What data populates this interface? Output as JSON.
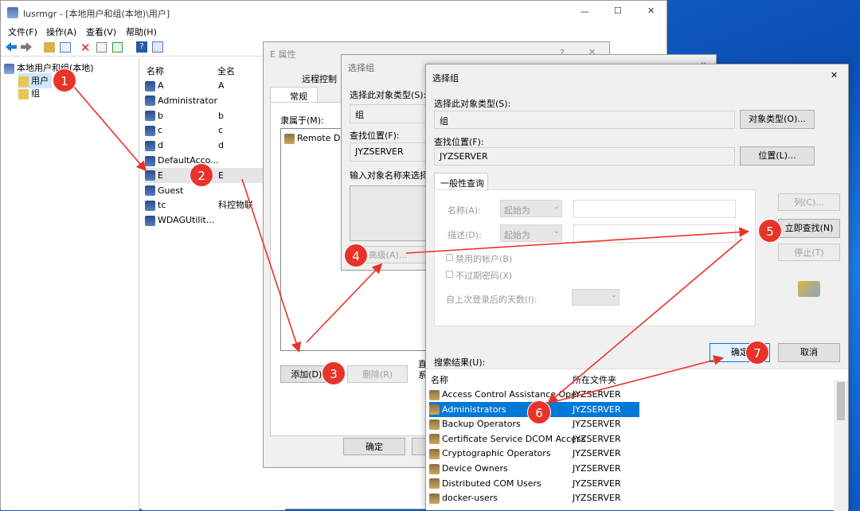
{
  "main": {
    "title": "lusrmgr - [本地用户和组(本地)\\用户]",
    "menu": [
      "文件(F)",
      "操作(A)",
      "查看(V)",
      "帮助(H)"
    ],
    "tree": {
      "root": "本地用户和组(本地)",
      "users": "用户",
      "groups": "组"
    },
    "list_headers": {
      "name": "名称",
      "fullname": "全名"
    },
    "users": [
      {
        "name": "A",
        "full": "A"
      },
      {
        "name": "Administrator",
        "full": ""
      },
      {
        "name": "b",
        "full": "b"
      },
      {
        "name": "c",
        "full": "c"
      },
      {
        "name": "d",
        "full": "d"
      },
      {
        "name": "DefaultAcco...",
        "full": ""
      },
      {
        "name": "E",
        "full": "E"
      },
      {
        "name": "Guest",
        "full": ""
      },
      {
        "name": "tc",
        "full": "科控物联"
      },
      {
        "name": "WDAGUtilit...",
        "full": ""
      }
    ],
    "win_controls": {
      "min": "—",
      "max": "☐",
      "close": "✕"
    }
  },
  "props": {
    "title": "E 属性",
    "help": "?",
    "close": "✕",
    "tabs": [
      "远程控制",
      "常规"
    ],
    "member_of": "隶属于(M):",
    "member_item": "Remote Des",
    "add": "添加(D)...",
    "remove": "删除(R)",
    "note1": "直",
    "note2": "系",
    "ok": "确定"
  },
  "sel1": {
    "title": "选择组",
    "close": "✕",
    "type_label": "选择此对象类型(S):",
    "type_value": "组",
    "loc_label": "查找位置(F):",
    "loc_value": "JYZSERVER",
    "enter_label": "输入对象名称来选择",
    "advanced": "高级(A)..."
  },
  "sel2": {
    "title": "选择组",
    "close": "✕",
    "type_label": "选择此对象类型(S):",
    "type_value": "组",
    "type_btn": "对象类型(O)...",
    "loc_label": "查找位置(F):",
    "loc_value": "JYZSERVER",
    "loc_btn": "位置(L)...",
    "tab": "一般性查询",
    "name_label": "名称(A):",
    "desc_label": "描述(D):",
    "starts_with": "起始为",
    "disabled": "禁用的帐户(B)",
    "noexpire": "不过期密码(X)",
    "days": "自上次登录后的天数(I):",
    "columns_btn": "列(C)...",
    "find_btn": "立即查找(N)",
    "stop_btn": "停止(T)",
    "ok": "确定",
    "cancel": "取消",
    "results_label": "搜索结果(U):",
    "col_name": "名称",
    "col_folder": "所在文件夹",
    "results": [
      {
        "name": "Access Control Assistance Oper",
        "folder": "JYZSERVER"
      },
      {
        "name": "Administrators",
        "folder": "JYZSERVER"
      },
      {
        "name": "Backup Operators",
        "folder": "JYZSERVER"
      },
      {
        "name": "Certificate Service DCOM Access",
        "folder": "JYZSERVER"
      },
      {
        "name": "Cryptographic Operators",
        "folder": "JYZSERVER"
      },
      {
        "name": "Device Owners",
        "folder": "JYZSERVER"
      },
      {
        "name": "Distributed COM Users",
        "folder": "JYZSERVER"
      },
      {
        "name": "docker-users",
        "folder": "JYZSERVER"
      }
    ]
  },
  "steps": [
    "1",
    "2",
    "3",
    "4",
    "5",
    "6",
    "7"
  ],
  "colors": {
    "accent": "#0078d7",
    "badge": "#e8332a",
    "selected": "#0078d7"
  }
}
